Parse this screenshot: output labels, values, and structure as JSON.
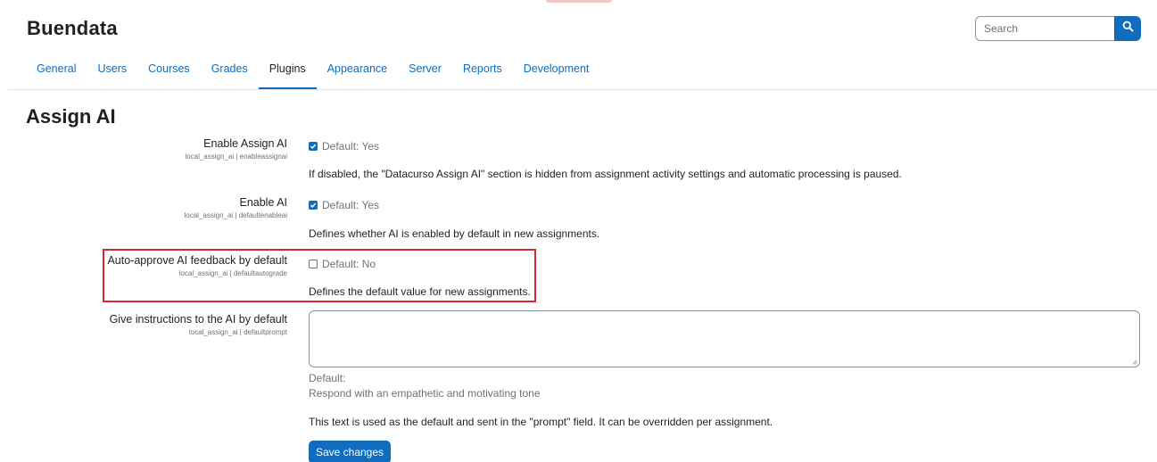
{
  "site": {
    "title": "Buendata"
  },
  "search": {
    "placeholder": "Search"
  },
  "tabs": [
    {
      "label": "General"
    },
    {
      "label": "Users"
    },
    {
      "label": "Courses"
    },
    {
      "label": "Grades"
    },
    {
      "label": "Plugins",
      "active": true
    },
    {
      "label": "Appearance"
    },
    {
      "label": "Server"
    },
    {
      "label": "Reports"
    },
    {
      "label": "Development"
    }
  ],
  "page": {
    "title": "Assign AI"
  },
  "settings": {
    "enable_assign_ai": {
      "label": "Enable Assign AI",
      "key": "local_assign_ai | enableassignai",
      "checked": true,
      "default": "Default: Yes",
      "description": "If disabled, the \"Datacurso Assign AI\" section is hidden from assignment activity settings and automatic processing is paused."
    },
    "enable_ai": {
      "label": "Enable AI",
      "key": "local_assign_ai | defaultenableai",
      "checked": true,
      "default": "Default: Yes",
      "description": "Defines whether AI is enabled by default in new assignments."
    },
    "auto_approve": {
      "label": "Auto-approve AI feedback by default",
      "key": "local_assign_ai | defaultautograde",
      "checked": false,
      "default": "Default: No",
      "description": "Defines the default value for new assignments."
    },
    "instructions": {
      "label": "Give instructions to the AI by default",
      "key": "local_assign_ai | defaultprompt",
      "value": "",
      "default_label": "Default:",
      "default_value": "Respond with an empathetic and motivating tone",
      "description": "This text is used as the default and sent in the \"prompt\" field. It can be overridden per assignment."
    }
  },
  "actions": {
    "save_label": "Save changes"
  },
  "colors": {
    "accent": "#0f6cbf",
    "highlight": "#d9262d",
    "text": "#1d2125",
    "muted": "#6a737b"
  }
}
